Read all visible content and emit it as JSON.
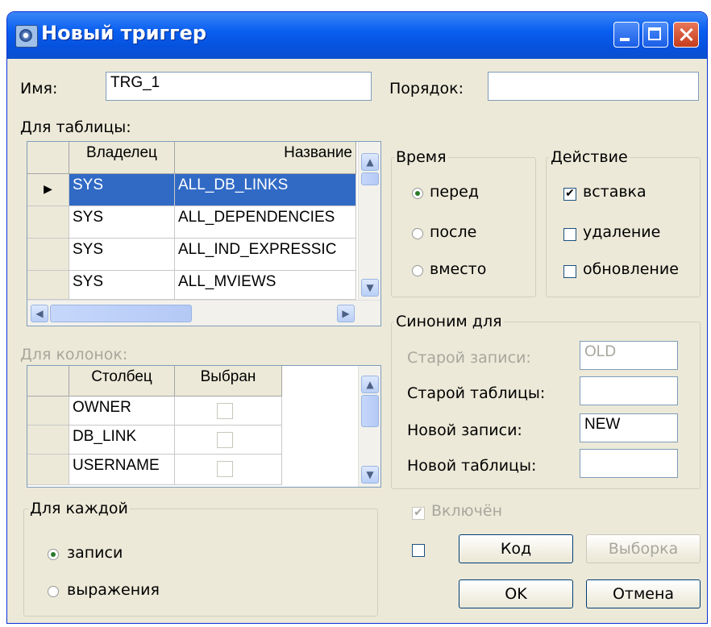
{
  "window": {
    "title": "Новый триггер"
  },
  "name_label": "Имя:",
  "name_value": "TRG_1",
  "order_label": "Порядок:",
  "order_value": "",
  "table_label": "Для таблицы:",
  "table": {
    "columns": [
      "Владелец",
      "Название"
    ],
    "rows": [
      {
        "owner": "SYS",
        "name": "ALL_DB_LINKS",
        "selected": true
      },
      {
        "owner": "SYS",
        "name": "ALL_DEPENDENCIES",
        "selected": false
      },
      {
        "owner": "SYS",
        "name": "ALL_IND_EXPRESSIC",
        "selected": false
      },
      {
        "owner": "SYS",
        "name": "ALL_MVIEWS",
        "selected": false
      }
    ]
  },
  "columns_label": "Для колонок:",
  "columns_grid": {
    "columns": [
      "Столбец",
      "Выбран"
    ],
    "rows": [
      {
        "name": "OWNER",
        "checked": false
      },
      {
        "name": "DB_LINK",
        "checked": false
      },
      {
        "name": "USERNAME",
        "checked": false
      }
    ]
  },
  "timing": {
    "title": "Время",
    "options": [
      "перед",
      "после",
      "вместо"
    ],
    "selected": "перед"
  },
  "action": {
    "title": "Действие",
    "options": [
      {
        "label": "вставка",
        "checked": true
      },
      {
        "label": "удаление",
        "checked": false
      },
      {
        "label": "обновление",
        "checked": false
      }
    ]
  },
  "synonym": {
    "title": "Синоним для",
    "old_record_label": "Старой записи:",
    "old_record_value": "OLD",
    "old_table_label": "Старой таблицы:",
    "old_table_value": "",
    "new_record_label": "Новой записи:",
    "new_record_value": "NEW",
    "new_table_label": "Новой таблицы:",
    "new_table_value": ""
  },
  "for_each": {
    "title": "Для каждой",
    "options": [
      "записи",
      "выражения"
    ],
    "selected": "записи"
  },
  "enabled_label": "Включён",
  "buttons": {
    "code": "Код",
    "select": "Выборка",
    "ok": "OK",
    "cancel": "Отмена"
  },
  "icons": {
    "scroll_up": "▲",
    "scroll_down": "▼",
    "scroll_left": "◀",
    "scroll_right": "▶",
    "row_pointer": "▶",
    "check": "✔"
  }
}
